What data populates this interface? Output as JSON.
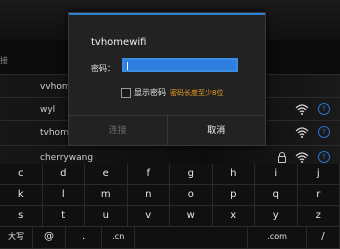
{
  "wifi_list": {
    "partial_header": "接",
    "networks": [
      {
        "ssid": "vvhom"
      },
      {
        "ssid": "wyl"
      },
      {
        "ssid": "tvhome"
      },
      {
        "ssid": "cherrywang"
      }
    ]
  },
  "dialog": {
    "title": "tvhomewifi",
    "password_label": "密码：",
    "password_value": "",
    "show_password_label": "显示密码",
    "password_hint": "密码长度至少8位",
    "connect_label": "连接",
    "cancel_label": "取消"
  },
  "keyboard": {
    "row1": [
      "c",
      "d",
      "e",
      "f",
      "g",
      "h",
      "i",
      "j"
    ],
    "row2": [
      "k",
      "l",
      "m",
      "n",
      "o",
      "p",
      "q",
      "r"
    ],
    "row3": [
      "s",
      "t",
      "u",
      "v",
      "w",
      "x",
      "y",
      "z"
    ],
    "row4": [
      "大写",
      "@",
      ".",
      ".cn",
      "",
      ".com",
      "/"
    ]
  },
  "colors": {
    "accent": "#2f7fe0",
    "hint": "#f0a020"
  }
}
